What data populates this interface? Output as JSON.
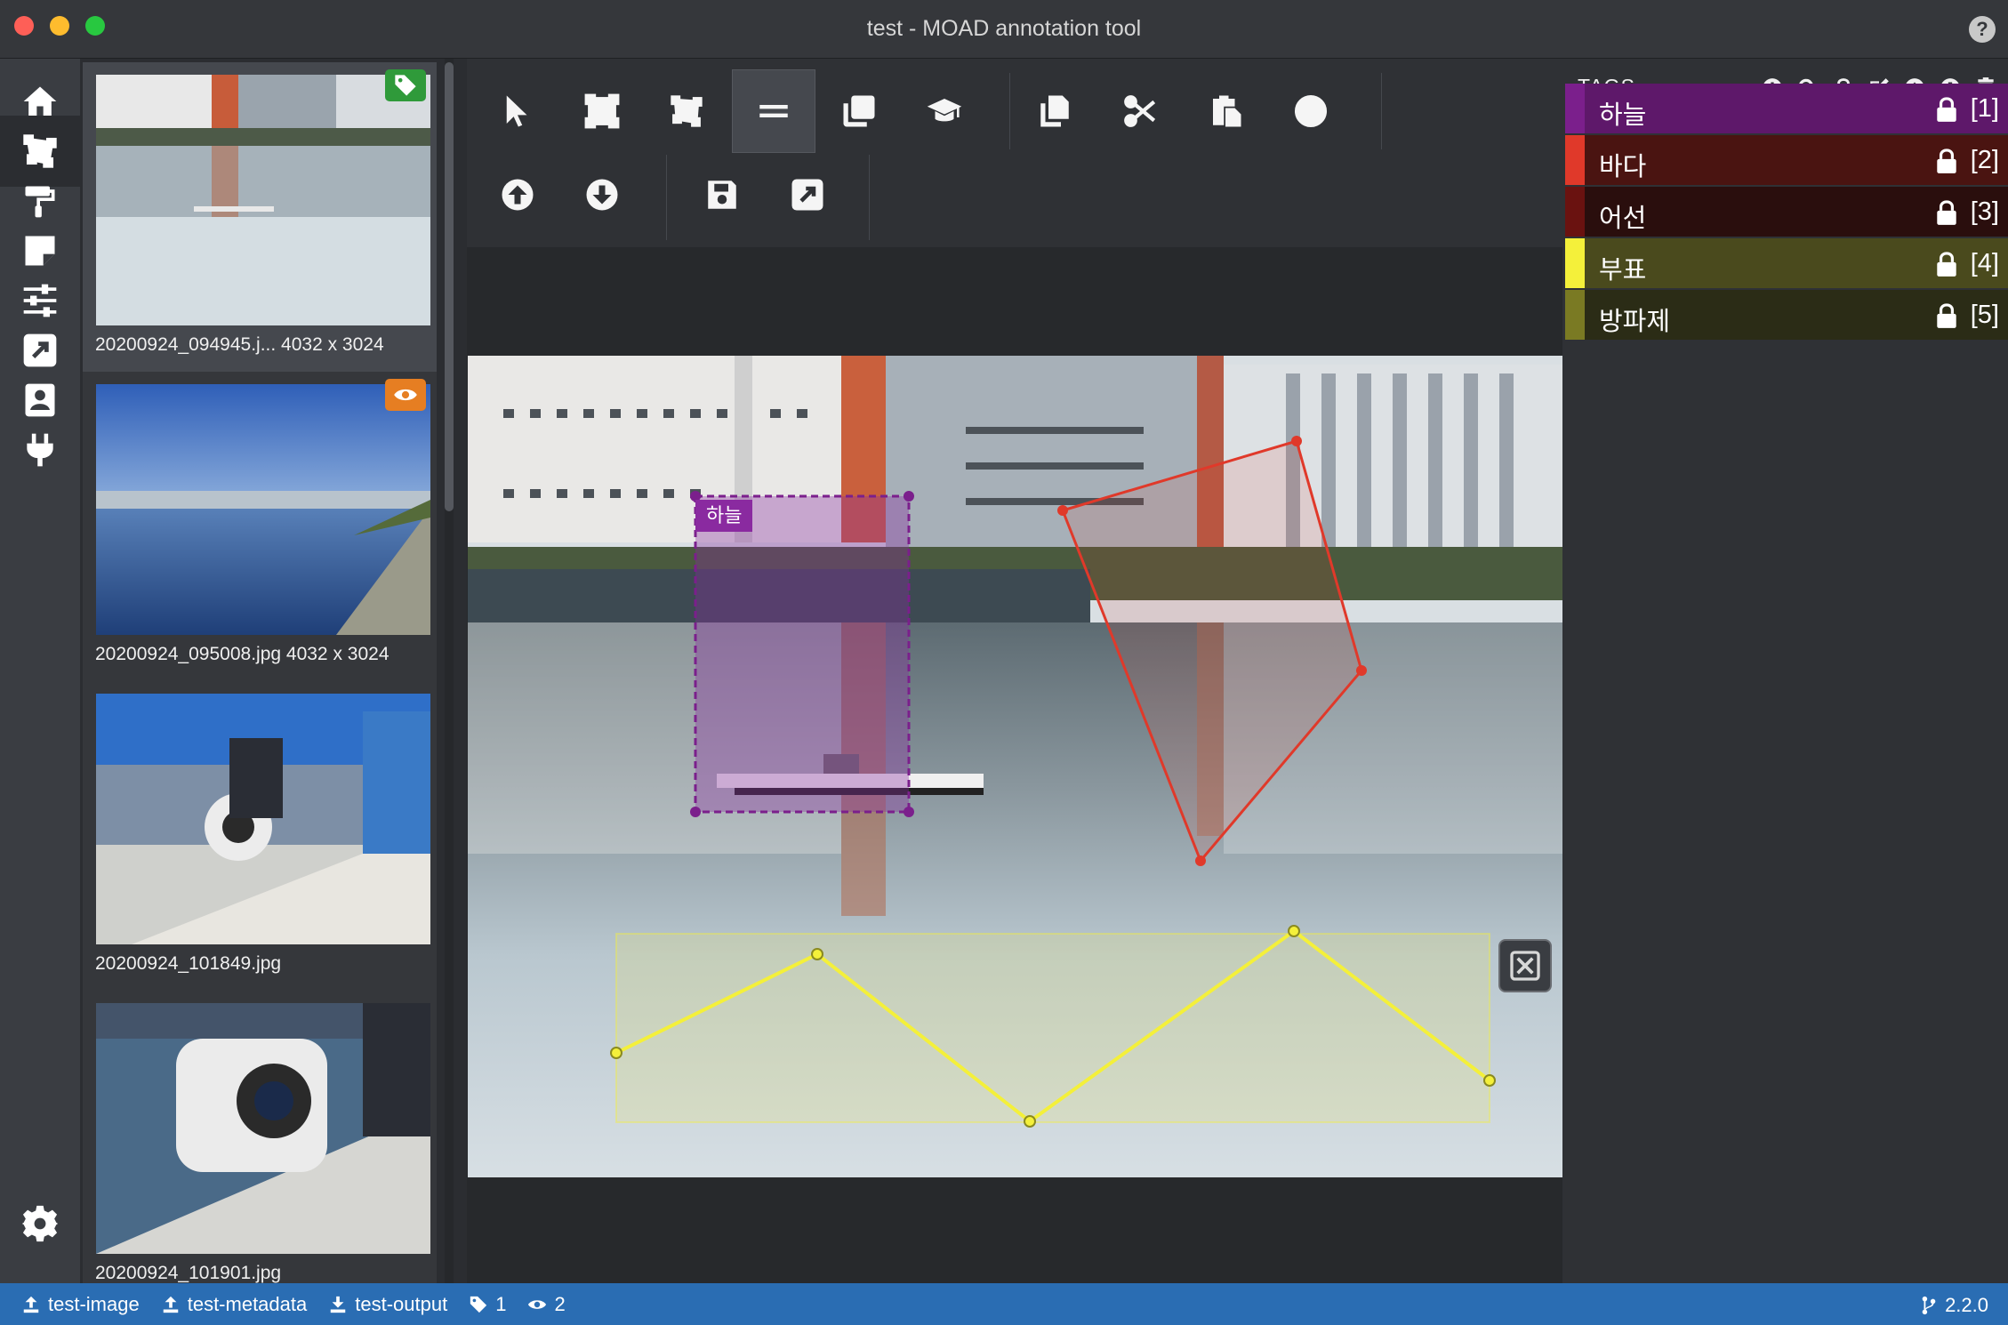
{
  "window": {
    "title": "test - MOAD annotation tool",
    "help": "?"
  },
  "nav": {
    "items": [
      "home",
      "editor",
      "paint",
      "notes",
      "settings-sliders",
      "export",
      "profile",
      "plugins",
      "settings"
    ]
  },
  "thumbnails": [
    {
      "name": "20200924_094945.j...",
      "size": "4032 x 3024",
      "badge": "tag"
    },
    {
      "name": "20200924_095008.jpg",
      "size": "4032 x 3024",
      "badge": "visited"
    },
    {
      "name": "20200924_101849.jpg",
      "size": ""
    },
    {
      "name": "20200924_101901.jpg",
      "size": ""
    }
  ],
  "canvas": {
    "region_label": "하늘"
  },
  "tags": {
    "header": "TAGS",
    "items": [
      {
        "name": "하늘",
        "hotkey": "[1]",
        "color": "#7b1f8c",
        "bg": "#5e186a"
      },
      {
        "name": "바다",
        "hotkey": "[2]",
        "color": "#e0392a",
        "bg": "#4a1411"
      },
      {
        "name": "어선",
        "hotkey": "[3]",
        "color": "#6a1210",
        "bg": "#2a0e0d"
      },
      {
        "name": "부표",
        "hotkey": "[4]",
        "color": "#f4f03a",
        "bg": "#4a4a1d"
      },
      {
        "name": "방파제",
        "hotkey": "[5]",
        "color": "#7a7a23",
        "bg": "#2b2c16"
      }
    ]
  },
  "statusbar": {
    "source": "test-image",
    "metadata": "test-metadata",
    "output": "test-output",
    "tagged_count": "1",
    "visited_count": "2",
    "version": "2.2.0"
  },
  "colors": {
    "accent": "#2a6db3",
    "polygon": "#e0392a",
    "polyline": "#f4f03a",
    "rect": "#7b1f8c"
  }
}
